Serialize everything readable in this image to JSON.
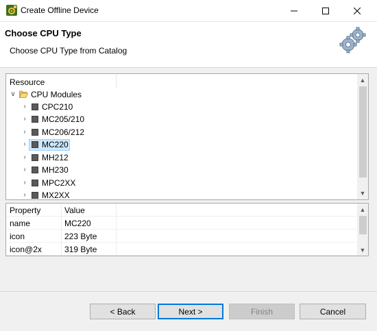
{
  "window": {
    "title": "Create Offline Device",
    "app_icon": "gear-app-icon",
    "controls": [
      "minimize-icon",
      "maximize-icon",
      "close-icon"
    ]
  },
  "header": {
    "title": "Choose CPU Type",
    "subtitle": "Choose CPU Type from Catalog",
    "icon": "gears-icon"
  },
  "tree": {
    "column_header": "Resource",
    "root": {
      "label": "CPU Modules",
      "expanded": true,
      "icon": "folder-open-icon"
    },
    "items": [
      {
        "label": "CPC210",
        "selected": false
      },
      {
        "label": "MC205/210",
        "selected": false
      },
      {
        "label": "MC206/212",
        "selected": false
      },
      {
        "label": "MC220",
        "selected": true
      },
      {
        "label": "MH212",
        "selected": false
      },
      {
        "label": "MH230",
        "selected": false
      },
      {
        "label": "MPC2XX",
        "selected": false
      },
      {
        "label": "MX2XX",
        "selected": false
      }
    ]
  },
  "properties": {
    "headers": {
      "property": "Property",
      "value": "Value"
    },
    "rows": [
      {
        "property": "name",
        "value": "MC220"
      },
      {
        "property": "icon",
        "value": "223 Byte"
      },
      {
        "property": "icon@2x",
        "value": "319 Byte"
      }
    ]
  },
  "buttons": {
    "back": "< Back",
    "next": "Next >",
    "finish": "Finish",
    "cancel": "Cancel"
  },
  "colors": {
    "selection": "#cce8ff",
    "default_button_border": "#0078d7",
    "folder": "#dcb35c"
  }
}
